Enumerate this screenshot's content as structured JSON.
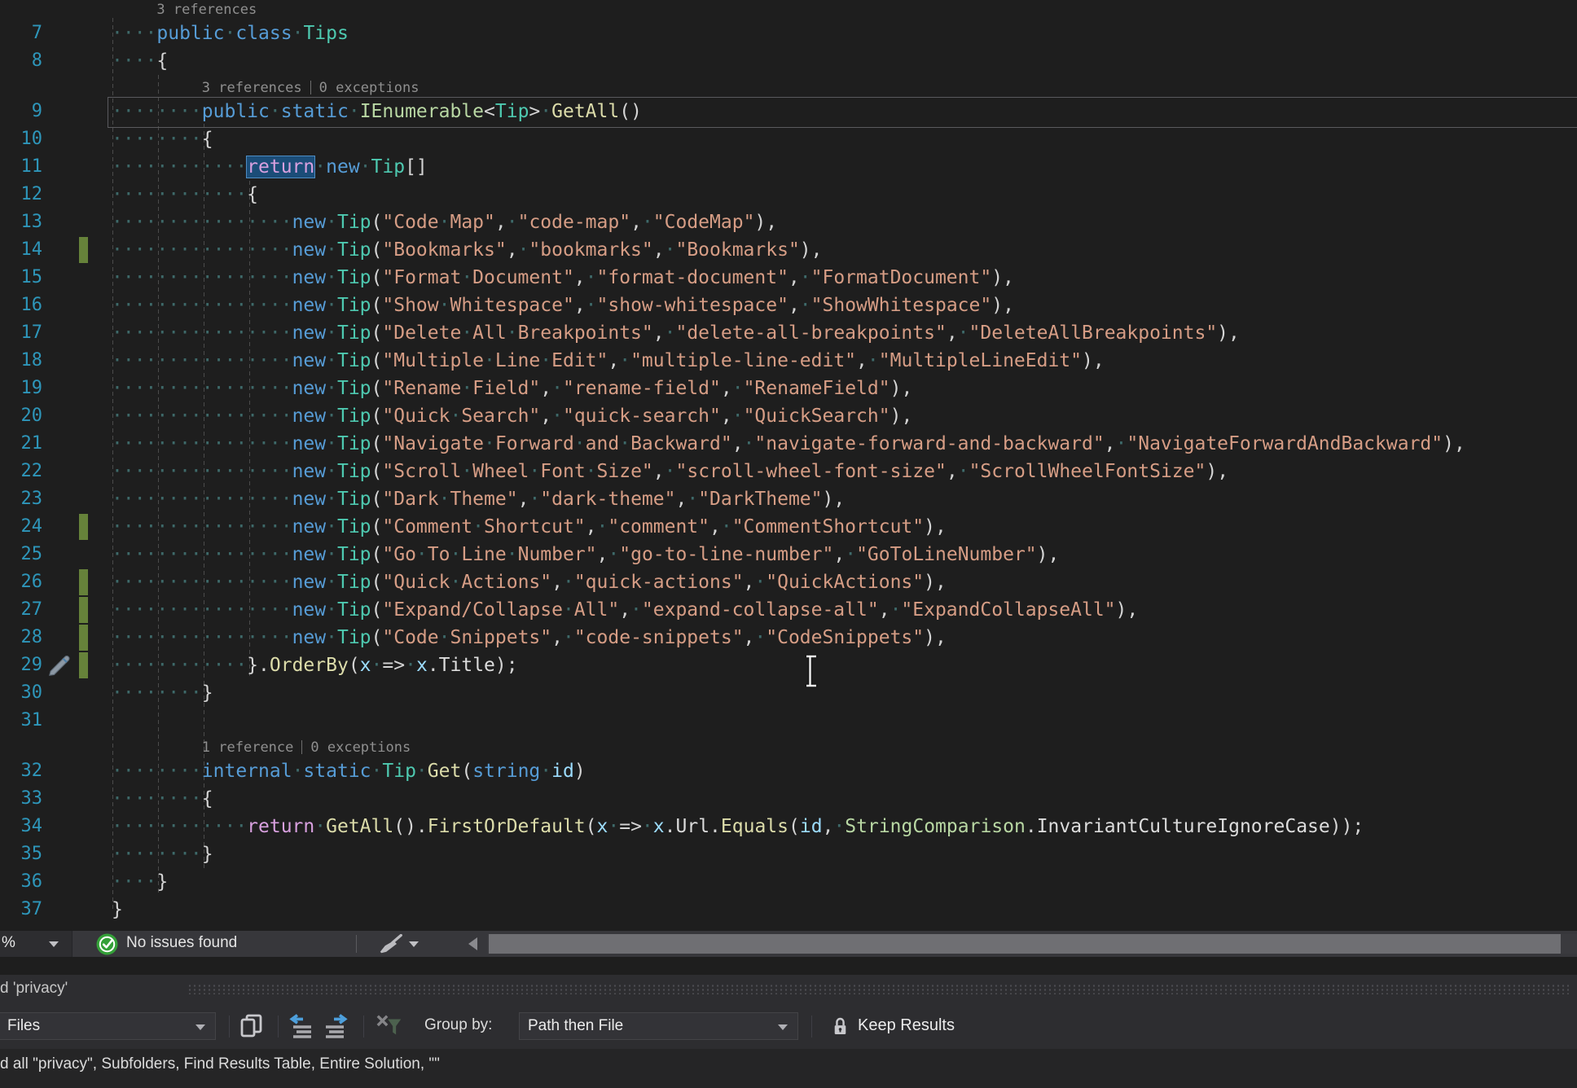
{
  "colors": {
    "editor_bg": "#1E1E1E",
    "keyword": "#569CD6",
    "control_keyword": "#D8A0DF",
    "type": "#4EC9B0",
    "interface_enum": "#B8D7A3",
    "method": "#DCDCAA",
    "parameter": "#9CDCFE",
    "string": "#D69D85",
    "punctuation": "#D4D4D4",
    "line_number": "#2E96BA",
    "whitespace_dot": "#3E6A6A",
    "selection_bg": "#1B4D78",
    "change_bar_green": "#66823A",
    "status_green": "#34A038"
  },
  "editor": {
    "rows": [
      {
        "cl": 1,
        "ind": 4,
        "parts": [
          "3 references"
        ]
      },
      {
        "n": 7,
        "ind": 4,
        "t": [
          [
            "public ",
            "k"
          ],
          [
            "class ",
            "k"
          ],
          [
            "Tips",
            "t"
          ]
        ]
      },
      {
        "n": 8,
        "ind": 4,
        "t": [
          [
            "{",
            "d"
          ]
        ]
      },
      {
        "cl": 1,
        "ind": 8,
        "parts": [
          "3 references",
          "0 exceptions"
        ]
      },
      {
        "n": 9,
        "ind": 8,
        "box": 1,
        "t": [
          [
            "public ",
            "k"
          ],
          [
            "static ",
            "k"
          ],
          [
            "IEnumerable",
            "i"
          ],
          [
            "<",
            "d"
          ],
          [
            "Tip",
            "t"
          ],
          [
            "> ",
            "d"
          ],
          [
            "GetAll",
            "m"
          ],
          [
            "()",
            "d"
          ]
        ]
      },
      {
        "n": 10,
        "ind": 8,
        "t": [
          [
            "{",
            "d"
          ]
        ]
      },
      {
        "n": 11,
        "ind": 12,
        "t": [
          [
            "return",
            "c",
            "sel"
          ],
          [
            " ",
            "d"
          ],
          [
            "new ",
            "k"
          ],
          [
            "Tip",
            "t"
          ],
          [
            "[]",
            "d"
          ]
        ]
      },
      {
        "n": 12,
        "ind": 12,
        "t": [
          [
            "{",
            "d"
          ]
        ]
      },
      {
        "n": 13,
        "ind": 16,
        "tip": [
          "Code Map",
          "code-map",
          "CodeMap"
        ]
      },
      {
        "n": 14,
        "ind": 16,
        "bar": 1,
        "tip": [
          "Bookmarks",
          "bookmarks",
          "Bookmarks"
        ]
      },
      {
        "n": 15,
        "ind": 16,
        "tip": [
          "Format Document",
          "format-document",
          "FormatDocument"
        ]
      },
      {
        "n": 16,
        "ind": 16,
        "tip": [
          "Show Whitespace",
          "show-whitespace",
          "ShowWhitespace"
        ]
      },
      {
        "n": 17,
        "ind": 16,
        "tip": [
          "Delete All Breakpoints",
          "delete-all-breakpoints",
          "DeleteAllBreakpoints"
        ]
      },
      {
        "n": 18,
        "ind": 16,
        "tip": [
          "Multiple Line Edit",
          "multiple-line-edit",
          "MultipleLineEdit"
        ]
      },
      {
        "n": 19,
        "ind": 16,
        "tip": [
          "Rename Field",
          "rename-field",
          "RenameField"
        ]
      },
      {
        "n": 20,
        "ind": 16,
        "tip": [
          "Quick Search",
          "quick-search",
          "QuickSearch"
        ]
      },
      {
        "n": 21,
        "ind": 16,
        "tip": [
          "Navigate Forward and Backward",
          "navigate-forward-and-backward",
          "NavigateForwardAndBackward"
        ]
      },
      {
        "n": 22,
        "ind": 16,
        "tip": [
          "Scroll Wheel Font Size",
          "scroll-wheel-font-size",
          "ScrollWheelFontSize"
        ]
      },
      {
        "n": 23,
        "ind": 16,
        "tip": [
          "Dark Theme",
          "dark-theme",
          "DarkTheme"
        ]
      },
      {
        "n": 24,
        "ind": 16,
        "bar": 1,
        "tip": [
          "Comment Shortcut",
          "comment",
          "CommentShortcut"
        ]
      },
      {
        "n": 25,
        "ind": 16,
        "tip": [
          "Go To Line Number",
          "go-to-line-number",
          "GoToLineNumber"
        ]
      },
      {
        "n": 26,
        "ind": 16,
        "bar": 1,
        "tip": [
          "Quick Actions",
          "quick-actions",
          "QuickActions"
        ]
      },
      {
        "n": 27,
        "ind": 16,
        "bar": 1,
        "tip": [
          "Expand/Collapse All",
          "expand-collapse-all",
          "ExpandCollapseAll"
        ]
      },
      {
        "n": 28,
        "ind": 16,
        "bar": 1,
        "tip": [
          "Code Snippets",
          "code-snippets",
          "CodeSnippets"
        ]
      },
      {
        "n": 29,
        "ind": 12,
        "bar": 1,
        "pen": 1,
        "t": [
          [
            "}.",
            "d"
          ],
          [
            "OrderBy",
            "m"
          ],
          [
            "(",
            "d"
          ],
          [
            "x",
            "p"
          ],
          [
            " => ",
            "d"
          ],
          [
            "x",
            "p"
          ],
          [
            ".",
            "d"
          ],
          [
            "Title",
            "w"
          ],
          [
            ");",
            "d"
          ]
        ]
      },
      {
        "n": 30,
        "ind": 8,
        "t": [
          [
            "}",
            "d"
          ]
        ]
      },
      {
        "n": 31,
        "ind": 0,
        "t": []
      },
      {
        "cl": 1,
        "ind": 8,
        "parts": [
          "1 reference",
          "0 exceptions"
        ]
      },
      {
        "n": 32,
        "ind": 8,
        "t": [
          [
            "internal ",
            "k"
          ],
          [
            "static ",
            "k"
          ],
          [
            "Tip ",
            "t"
          ],
          [
            "Get",
            "m"
          ],
          [
            "(",
            "d"
          ],
          [
            "string ",
            "k"
          ],
          [
            "id",
            "p"
          ],
          [
            ")",
            "d"
          ]
        ]
      },
      {
        "n": 33,
        "ind": 8,
        "t": [
          [
            "{",
            "d"
          ]
        ]
      },
      {
        "n": 34,
        "ind": 12,
        "t": [
          [
            "return ",
            "c"
          ],
          [
            "GetAll",
            "m"
          ],
          [
            "().",
            "d"
          ],
          [
            "FirstOrDefault",
            "m"
          ],
          [
            "(",
            "d"
          ],
          [
            "x",
            "p"
          ],
          [
            " => ",
            "d"
          ],
          [
            "x",
            "p"
          ],
          [
            ".",
            "d"
          ],
          [
            "Url",
            "w"
          ],
          [
            ".",
            "d"
          ],
          [
            "Equals",
            "m"
          ],
          [
            "(",
            "d"
          ],
          [
            "id",
            "p"
          ],
          [
            ", ",
            "d"
          ],
          [
            "StringComparison",
            "i"
          ],
          [
            ".",
            "d"
          ],
          [
            "InvariantCultureIgnoreCase",
            "w"
          ],
          [
            "));",
            "d"
          ]
        ]
      },
      {
        "n": 35,
        "ind": 8,
        "t": [
          [
            "}",
            "d"
          ]
        ]
      },
      {
        "n": 36,
        "ind": 4,
        "t": [
          [
            "}",
            "d"
          ]
        ]
      },
      {
        "n": 37,
        "ind": 0,
        "t": [
          [
            "}",
            "d"
          ]
        ]
      }
    ],
    "tip_tokens": {
      "kw_new": "new ",
      "type_tip": "Tip"
    }
  },
  "status_bar": {
    "zoom_suffix": "%",
    "message": "No issues found"
  },
  "find_panel": {
    "title": "d 'privacy'",
    "toolbar": {
      "scope_value": "Files",
      "group_by_label": "Group by:",
      "group_by_value": "Path then File",
      "keep_results_label": "Keep Results"
    },
    "summary": "d all \"privacy\", Subfolders, Find Results Table, Entire Solution, \"\""
  }
}
